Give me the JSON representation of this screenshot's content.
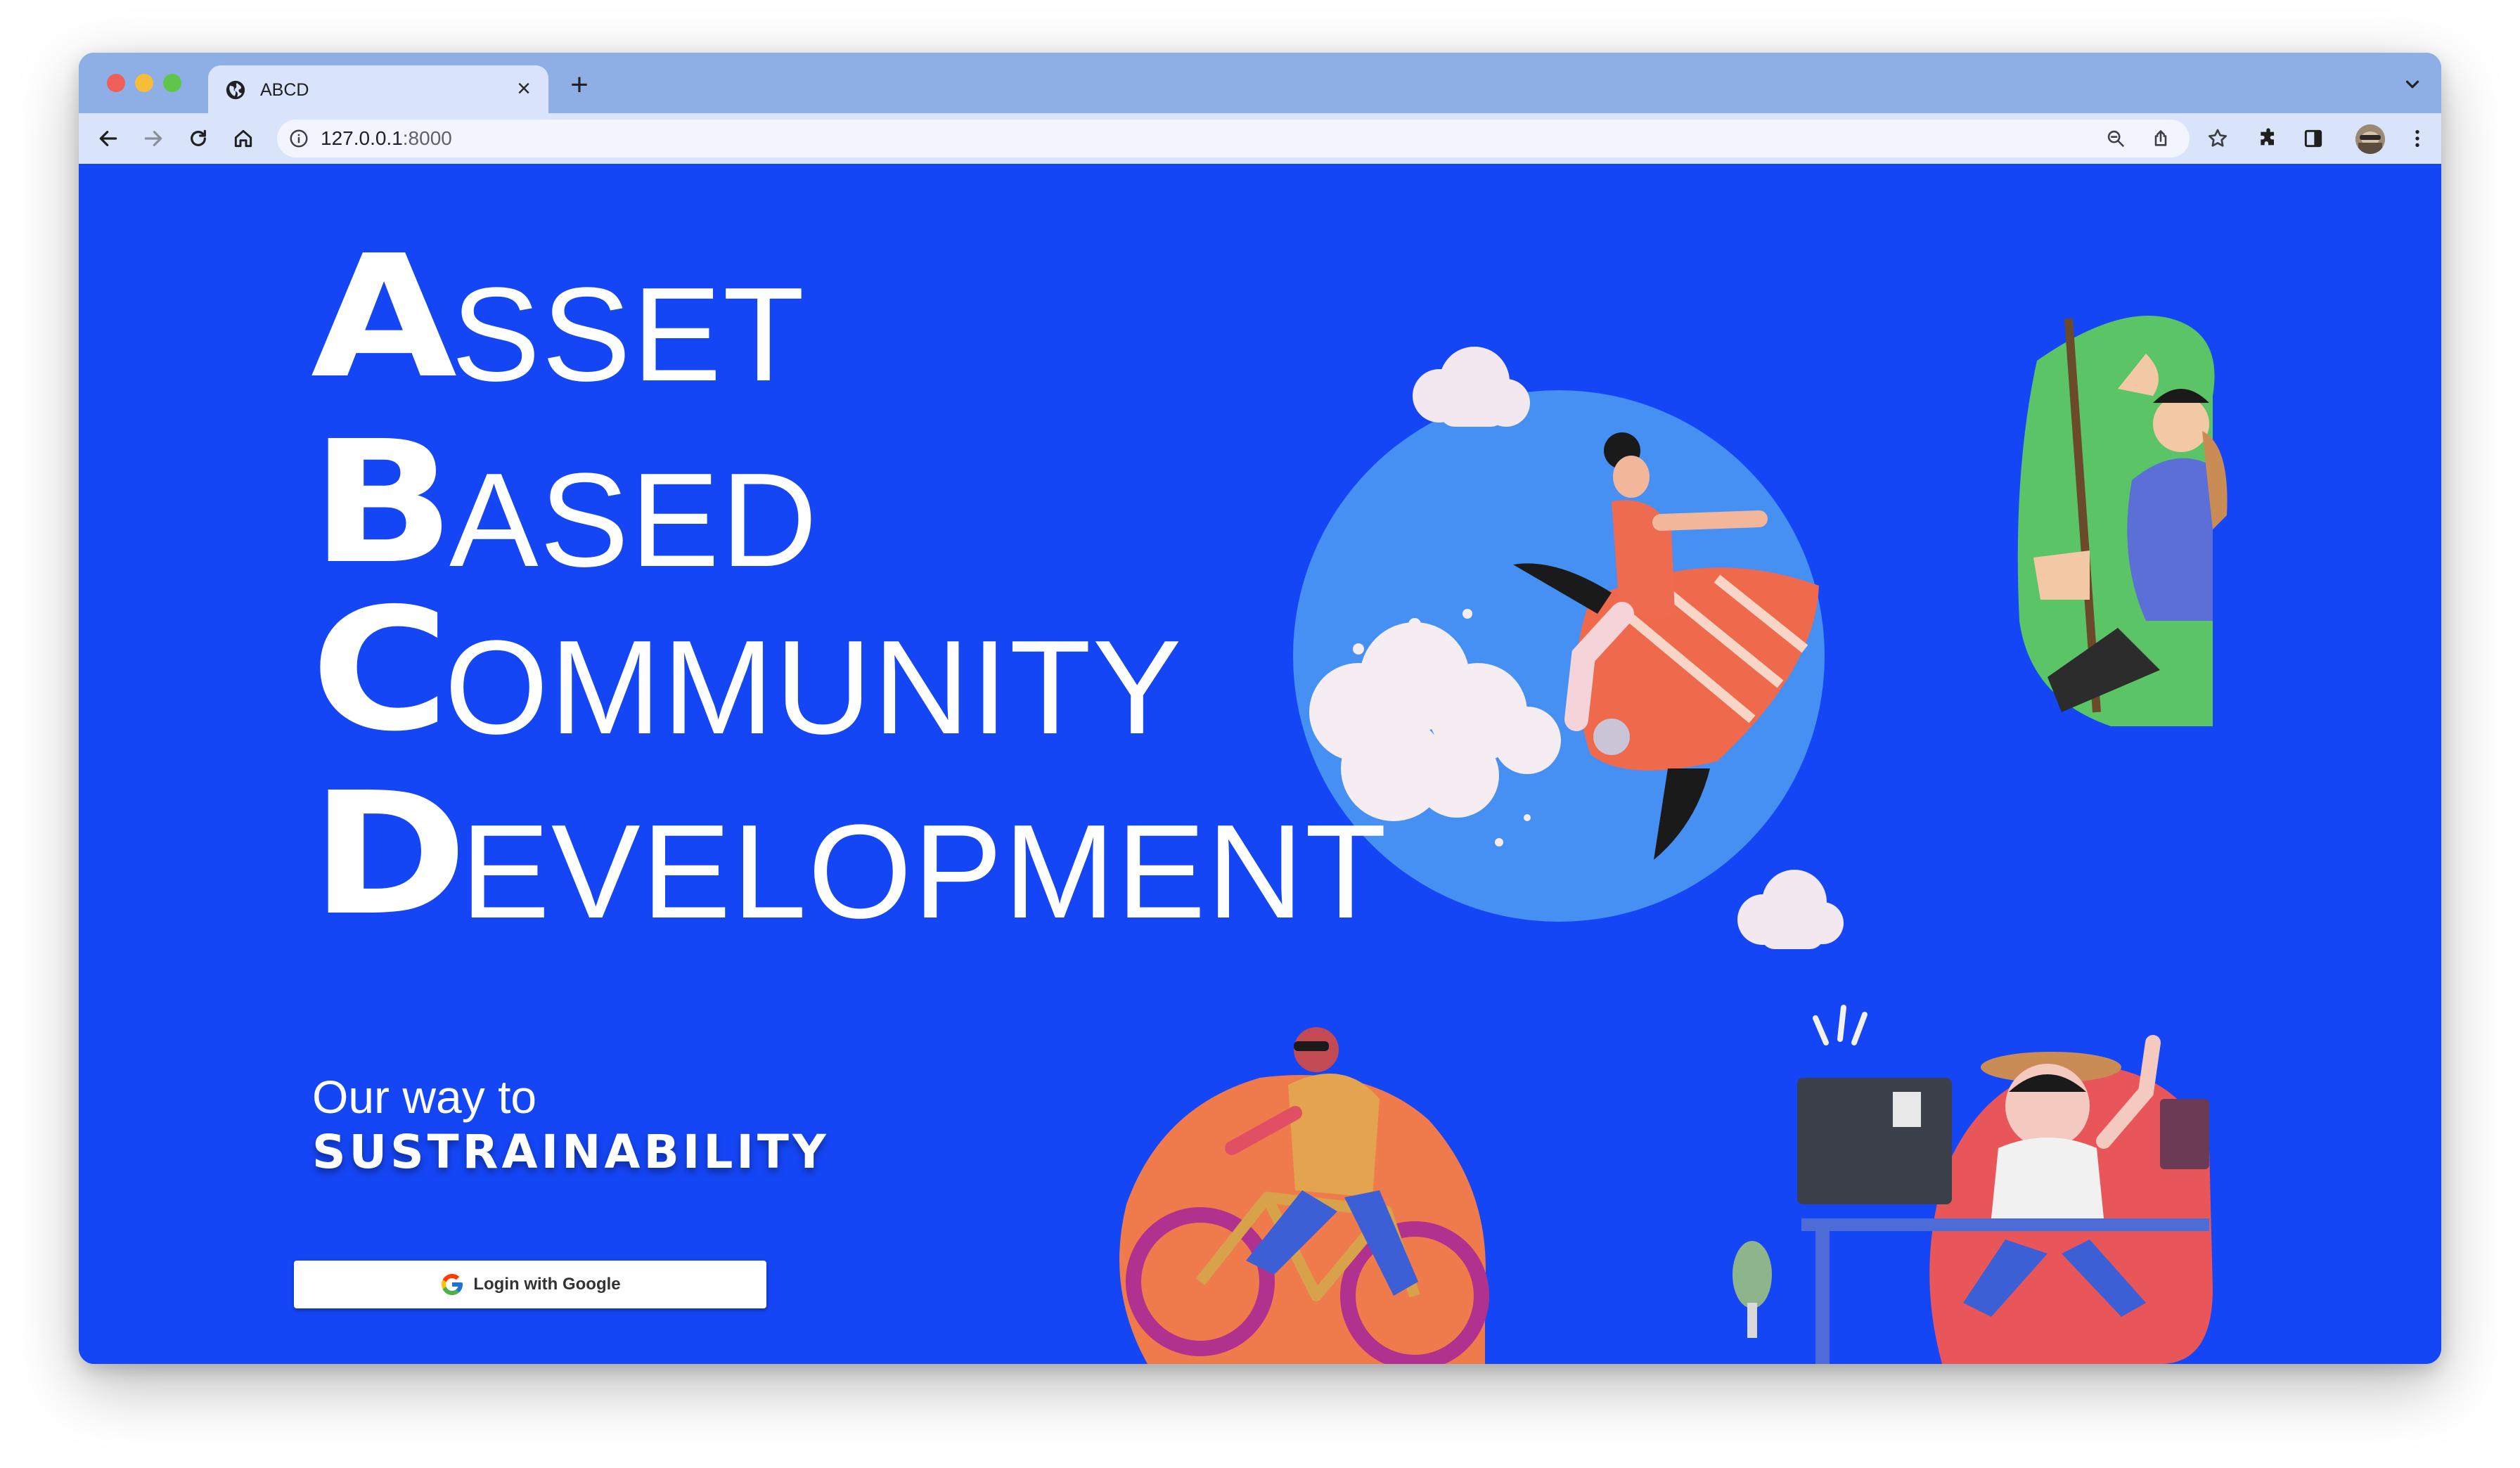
{
  "browser": {
    "tab_title": "ABCD",
    "url_host": "127.0.0.1",
    "url_port": ":8000",
    "tab_close_glyph": "×",
    "new_tab_glyph": "+"
  },
  "hero": {
    "lines": [
      {
        "initial": "A",
        "rest": "SSET"
      },
      {
        "initial": "B",
        "rest": "ASED"
      },
      {
        "initial": "C",
        "rest": "OMMUNITY"
      },
      {
        "initial": "D",
        "rest": "EVELOPMENT"
      }
    ],
    "tagline_1": "Our way to",
    "tagline_2": "SUSTRAINABILITY"
  },
  "auth": {
    "login_label": "Login with Google"
  },
  "colors": {
    "page_bg": "#1546f5",
    "tabstrip": "#8eaee6",
    "toolbar": "#d9e3f9",
    "circle_blue": "#4590f2",
    "blob_green": "#5bc466",
    "blob_orange": "#ef7b4c",
    "blob_red": "#e8565a"
  },
  "icons": [
    "globe-icon",
    "close-icon",
    "plus-icon",
    "chevron-down-icon",
    "back-arrow-icon",
    "forward-arrow-icon",
    "reload-icon",
    "home-icon",
    "info-icon",
    "zoom-icon",
    "share-icon",
    "star-icon",
    "extensions-icon",
    "sidepanel-icon",
    "kebab-menu-icon",
    "google-g-icon"
  ]
}
